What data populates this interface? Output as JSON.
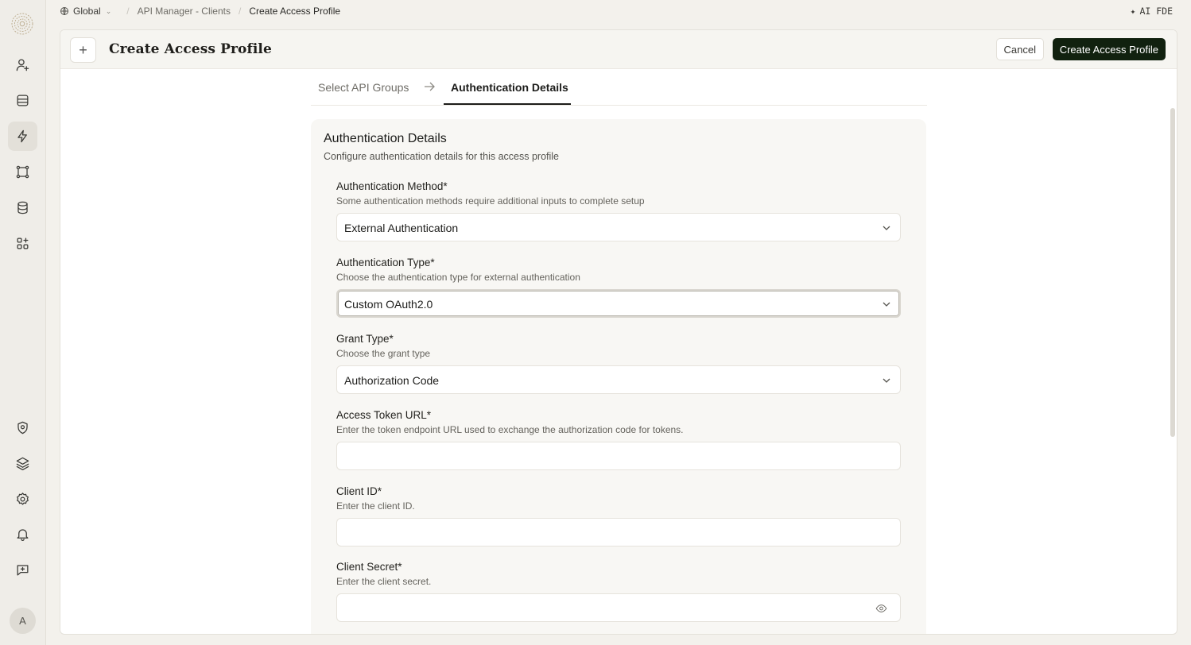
{
  "breadcrumb": {
    "global": "Global",
    "section": "API Manager - Clients",
    "current": "Create Access Profile"
  },
  "top_right": {
    "ai_label": "AI FDE"
  },
  "header": {
    "title": "Create Access Profile",
    "cancel_label": "Cancel",
    "create_label": "Create Access Profile"
  },
  "steps": {
    "step1": "Select API Groups",
    "step2": "Authentication Details"
  },
  "card": {
    "title": "Authentication Details",
    "subtitle": "Configure authentication details for this access profile"
  },
  "fields": {
    "auth_method": {
      "label": "Authentication Method*",
      "help": "Some authentication methods require additional inputs to complete setup",
      "value": "External Authentication"
    },
    "auth_type": {
      "label": "Authentication Type*",
      "help": "Choose the authentication type for external authentication",
      "value": "Custom OAuth2.0"
    },
    "grant_type": {
      "label": "Grant Type*",
      "help": "Choose the grant type",
      "value": "Authorization Code"
    },
    "access_token_url": {
      "label": "Access Token URL*",
      "help": "Enter the token endpoint URL used to exchange the authorization code for tokens.",
      "value": ""
    },
    "client_id": {
      "label": "Client ID*",
      "help": "Enter the client ID.",
      "value": ""
    },
    "client_secret": {
      "label": "Client Secret*",
      "help": "Enter the client secret.",
      "value": ""
    }
  },
  "user": {
    "avatar_initial": "A"
  },
  "icons": {
    "rail_top": [
      "user-plus-icon",
      "inbox-icon",
      "lightning-icon",
      "nodes-icon",
      "database-icon",
      "apps-plus-icon"
    ],
    "rail_bottom": [
      "shield-gear-icon",
      "layers-icon",
      "settings-icon",
      "bell-icon",
      "chat-plus-icon"
    ]
  },
  "colors": {
    "primary_button": "#11210f",
    "background": "#f3f1ec"
  }
}
